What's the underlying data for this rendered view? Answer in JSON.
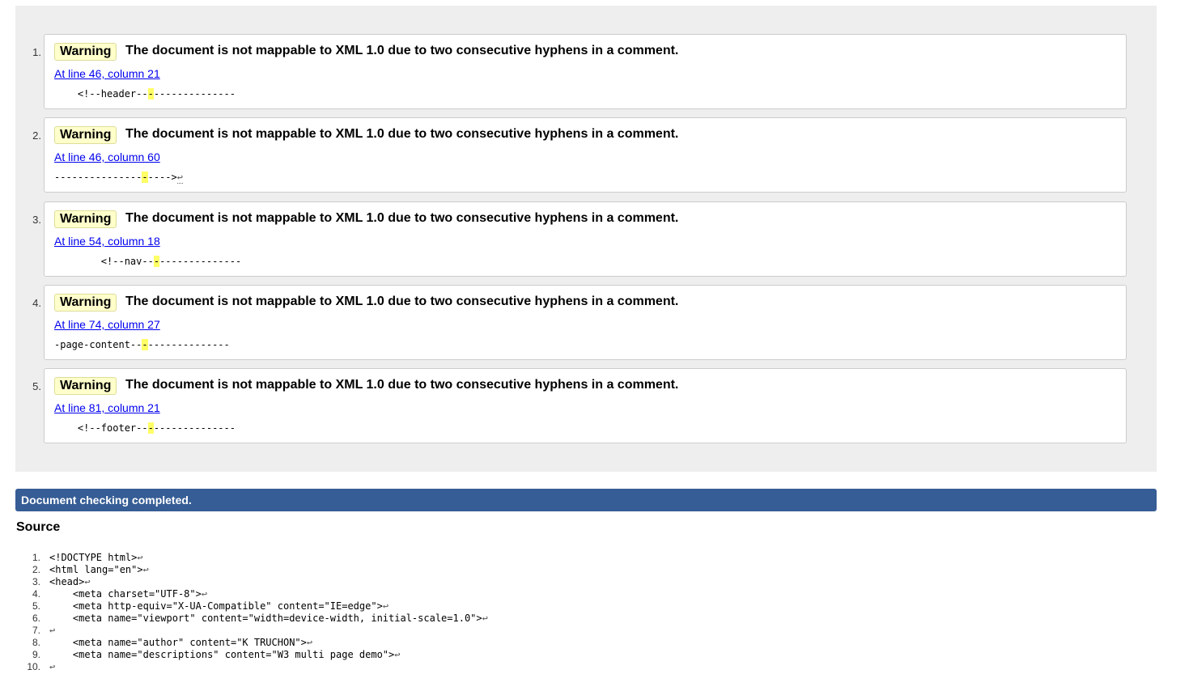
{
  "messages": [
    {
      "num": "1.",
      "type": "Warning",
      "text": "The document is not mappable to XML 1.0 due to two consecutive hyphens in a comment.",
      "location": "At line 46, column 21",
      "extract_pre": "    <!--header--",
      "extract_hl": "-",
      "extract_post": "--------------",
      "extract_lf": ""
    },
    {
      "num": "2.",
      "type": "Warning",
      "text": "The document is not mappable to XML 1.0 due to two consecutive hyphens in a comment.",
      "location": "At line 46, column 60",
      "extract_pre": "---------------",
      "extract_hl": "-",
      "extract_post": "---->",
      "extract_lf": "↩"
    },
    {
      "num": "3.",
      "type": "Warning",
      "text": "The document is not mappable to XML 1.0 due to two consecutive hyphens in a comment.",
      "location": "At line 54, column 18",
      "extract_pre": "        <!--nav--",
      "extract_hl": "-",
      "extract_post": "--------------",
      "extract_lf": ""
    },
    {
      "num": "4.",
      "type": "Warning",
      "text": "The document is not mappable to XML 1.0 due to two consecutive hyphens in a comment.",
      "location": "At line 74, column 27",
      "extract_pre": "-page-content--",
      "extract_hl": "-",
      "extract_post": "--------------",
      "extract_lf": ""
    },
    {
      "num": "5.",
      "type": "Warning",
      "text": "The document is not mappable to XML 1.0 due to two consecutive hyphens in a comment.",
      "location": "At line 81, column 21",
      "extract_pre": "    <!--footer--",
      "extract_hl": "-",
      "extract_post": "--------------",
      "extract_lf": ""
    }
  ],
  "status": "Document checking completed.",
  "source_heading": "Source",
  "source_lines": [
    {
      "num": "1.",
      "code": "<!DOCTYPE html>"
    },
    {
      "num": "2.",
      "code": "<html lang=\"en\">"
    },
    {
      "num": "3.",
      "code": "<head>"
    },
    {
      "num": "4.",
      "code": "    <meta charset=\"UTF-8\">"
    },
    {
      "num": "5.",
      "code": "    <meta http-equiv=\"X-UA-Compatible\" content=\"IE=edge\">"
    },
    {
      "num": "6.",
      "code": "    <meta name=\"viewport\" content=\"width=device-width, initial-scale=1.0\">"
    },
    {
      "num": "7.",
      "code": ""
    },
    {
      "num": "8.",
      "code": "    <meta name=\"author\" content=\"K TRUCHON\">"
    },
    {
      "num": "9.",
      "code": "    <meta name=\"descriptions\" content=\"W3 multi page demo\">"
    },
    {
      "num": "10.",
      "code": ""
    }
  ],
  "line_end_glyph": "↩",
  "colors": {
    "status_bar": "#365d95",
    "warning_badge": "#ffffcc",
    "highlight": "#ffff66",
    "link": "#0000ee"
  }
}
